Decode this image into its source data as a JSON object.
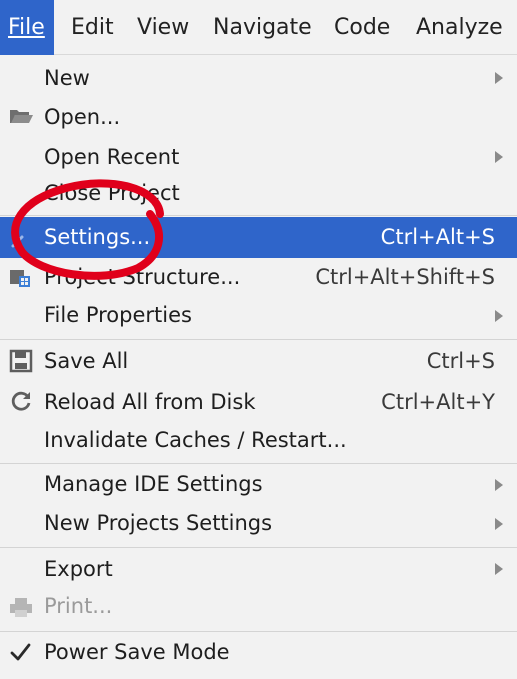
{
  "menubar": {
    "items": [
      {
        "label": "File"
      },
      {
        "label": "Edit"
      },
      {
        "label": "View"
      },
      {
        "label": "Navigate"
      },
      {
        "label": "Code"
      },
      {
        "label": "Analyze"
      }
    ]
  },
  "file_menu": {
    "new": {
      "label": "New"
    },
    "open": {
      "label": "Open..."
    },
    "open_recent": {
      "label": "Open Recent"
    },
    "close_project": {
      "label": "Close Project"
    },
    "settings": {
      "label": "Settings...",
      "shortcut": "Ctrl+Alt+S"
    },
    "project_structure": {
      "label": "Project Structure...",
      "shortcut": "Ctrl+Alt+Shift+S"
    },
    "file_properties": {
      "label": "File Properties"
    },
    "save_all": {
      "label": "Save All",
      "shortcut": "Ctrl+S"
    },
    "reload_all": {
      "label": "Reload All from Disk",
      "shortcut": "Ctrl+Alt+Y"
    },
    "invalidate_caches": {
      "label": "Invalidate Caches / Restart..."
    },
    "manage_ide_settings": {
      "label": "Manage IDE Settings"
    },
    "new_projects_settings": {
      "label": "New Projects Settings"
    },
    "export": {
      "label": "Export"
    },
    "print": {
      "label": "Print..."
    },
    "power_save_mode": {
      "label": "Power Save Mode"
    }
  },
  "colors": {
    "selection": "#2f65ca",
    "annotation": "#e0001b"
  }
}
